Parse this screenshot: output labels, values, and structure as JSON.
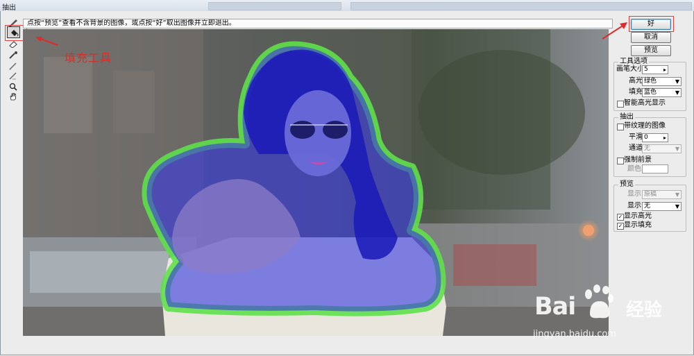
{
  "window": {
    "title": "抽出"
  },
  "instruction": "点按“预览”查看不含背景的图像，或点按“好”取出图像并立即退出。",
  "annotation": {
    "label": "填充工具"
  },
  "tools": [
    {
      "name": "edge-highlighter-tool"
    },
    {
      "name": "fill-tool",
      "selected": true
    },
    {
      "name": "eraser-tool"
    },
    {
      "name": "eyedropper-tool"
    },
    {
      "name": "cleanup-tool"
    },
    {
      "name": "edge-touchup-tool"
    },
    {
      "name": "zoom-tool"
    },
    {
      "name": "hand-tool"
    }
  ],
  "buttons": {
    "ok": "好",
    "cancel": "取消",
    "preview": "预览"
  },
  "tool_options": {
    "legend": "工具选项",
    "brush_size_label": "画笔大小:",
    "brush_size_value": "5",
    "highlight_label": "高光:",
    "highlight_value": "绿色",
    "fill_label": "填充:",
    "fill_value": "蓝色",
    "smart_highlight_label": "智能高光显示",
    "smart_highlight_checked": false
  },
  "extraction": {
    "legend": "抽出",
    "textured_label": "带纹理的图像",
    "textured_checked": false,
    "smooth_label": "平滑:",
    "smooth_value": "0",
    "channel_label": "通道:",
    "channel_value": "无",
    "force_fg_label": "强制前景",
    "force_fg_checked": false,
    "color_label": "颜色:"
  },
  "preview": {
    "legend": "预览",
    "show_label": "显示:",
    "show_value": "原稿",
    "display_label": "显示:",
    "display_value": "无",
    "show_highlight_label": "显示高光",
    "show_highlight_checked": true,
    "show_fill_label": "显示填充",
    "show_fill_checked": true
  },
  "watermark": {
    "brand": "Bai",
    "brand_cn": "经验",
    "url": "jingyan.baidu.com"
  },
  "colors": {
    "highlight": "#5fe04a",
    "fill": "#3434d8",
    "annotation": "#d0322b"
  }
}
